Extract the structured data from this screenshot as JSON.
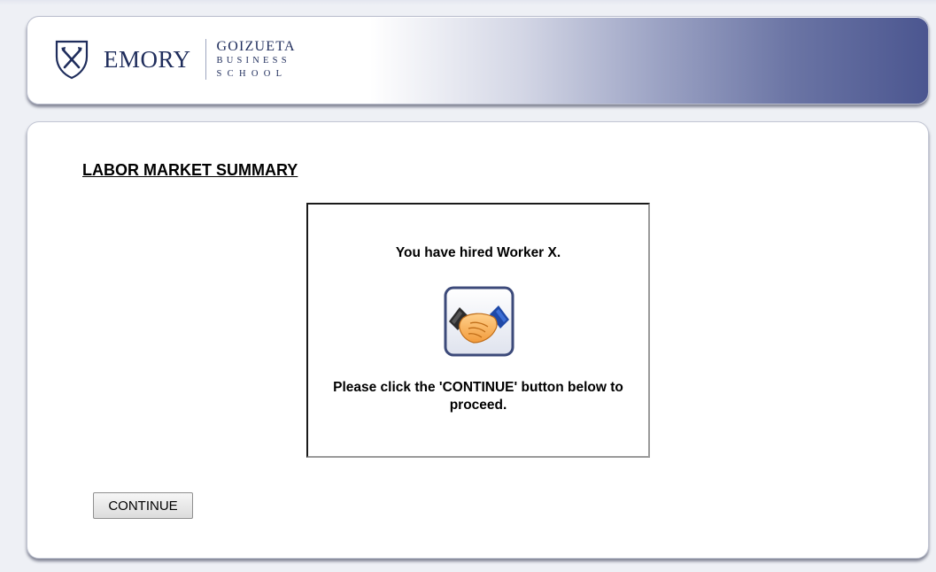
{
  "header": {
    "brand_primary": "EMORY",
    "brand_secondary_line1": "GOIZUETA",
    "brand_secondary_line2": "BUSINESS",
    "brand_secondary_line3": "SCHOOL",
    "shield_icon": "emory-shield-icon",
    "brand_color": "#1f2d5c",
    "banner_gradient_end": "#4b5690"
  },
  "main": {
    "title": "LABOR MARKET SUMMARY",
    "modal": {
      "message": "You have hired Worker X.",
      "icon": "handshake-icon",
      "instruction": "Please click the 'CONTINUE' button below to proceed."
    },
    "continue_label": "CONTINUE"
  }
}
